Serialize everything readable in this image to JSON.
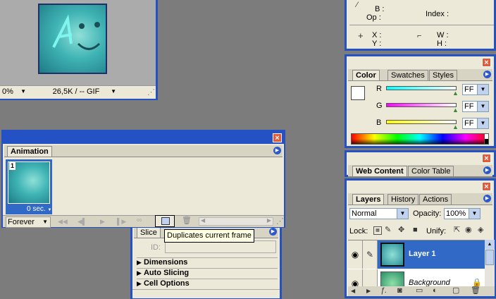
{
  "image_window": {
    "zoom": "0%",
    "size_info": "26,5K / -- GIF"
  },
  "info_panel": {
    "b_label": "B :",
    "op_label": "Op :",
    "index_label": "Index :",
    "x_label": "X :",
    "y_label": "Y :",
    "w_label": "W :",
    "h_label": "H :"
  },
  "color_panel": {
    "tabs": [
      "Color",
      "Swatches",
      "Styles"
    ],
    "channels": [
      {
        "label": "R",
        "value": "FF"
      },
      {
        "label": "G",
        "value": "FF"
      },
      {
        "label": "B",
        "value": "FF"
      }
    ]
  },
  "web_panel": {
    "tabs": [
      "Web Content",
      "Color Table"
    ]
  },
  "layers_panel": {
    "tabs": [
      "Layers",
      "History",
      "Actions"
    ],
    "blend_mode": "Normal",
    "opacity_label": "Opacity:",
    "opacity_value": "100%",
    "lock_label": "Lock:",
    "unify_label": "Unify:",
    "layers": [
      {
        "name": "Layer 1",
        "selected": true
      },
      {
        "name": "Background",
        "selected": false
      }
    ]
  },
  "animation_panel": {
    "tab": "Animation",
    "frame_number": "1",
    "frame_delay": "0 sec.",
    "loop": "Forever",
    "tooltip": "Duplicates current frame"
  },
  "slice_panel": {
    "tab": "Slice",
    "id_label": "ID:",
    "sections": [
      "Dimensions",
      "Auto Slicing",
      "Cell Options"
    ]
  },
  "colors": {
    "titlebar": "#2451c4",
    "panel_bg": "#ece9d8",
    "desktop": "#7c7c7c",
    "selection": "#3169c6"
  }
}
